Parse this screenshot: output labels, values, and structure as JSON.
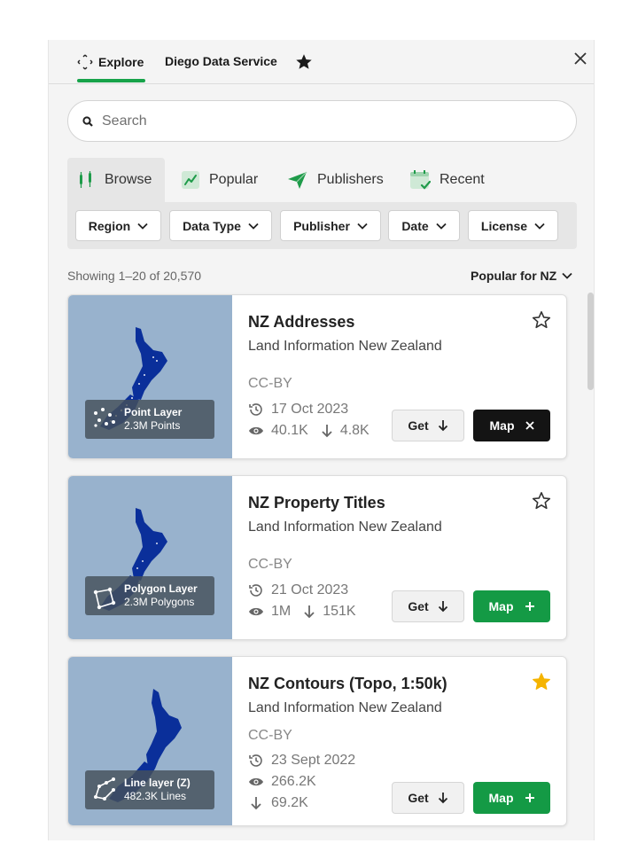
{
  "header": {
    "tabs": [
      {
        "label": "Explore",
        "active": true
      },
      {
        "label": "Diego Data Service",
        "active": false
      }
    ],
    "favorites_icon": "star-icon",
    "close_icon": "close-icon"
  },
  "search": {
    "placeholder": "Search",
    "value": ""
  },
  "nav": {
    "tabs": [
      {
        "label": "Browse",
        "icon": "browse-icon",
        "active": true
      },
      {
        "label": "Popular",
        "icon": "trend-icon",
        "active": false
      },
      {
        "label": "Publishers",
        "icon": "send-icon",
        "active": false
      },
      {
        "label": "Recent",
        "icon": "calendar-check-icon",
        "active": false
      }
    ]
  },
  "filters": [
    "Region",
    "Data Type",
    "Publisher",
    "Date",
    "License"
  ],
  "results": {
    "showing": "Showing 1–20 of 20,570",
    "sort_label": "Popular for NZ"
  },
  "cards": [
    {
      "title": "NZ Addresses",
      "publisher": "Land Information New Zealand",
      "license": "CC-BY",
      "date": "17 Oct 2023",
      "views": "40.1K",
      "downloads": "4.8K",
      "layer_type": "Point Layer",
      "layer_count": "2.3M Points",
      "starred": false,
      "get_label": "Get",
      "map_label": "Map",
      "on_map": true
    },
    {
      "title": "NZ Property Titles",
      "publisher": "Land Information New Zealand",
      "license": "CC-BY",
      "date": "21 Oct 2023",
      "views": "1M",
      "downloads": "151K",
      "layer_type": "Polygon Layer",
      "layer_count": "2.3M Polygons",
      "starred": false,
      "get_label": "Get",
      "map_label": "Map",
      "on_map": false
    },
    {
      "title": "NZ Contours (Topo, 1:50k)",
      "publisher": "Land Information New Zealand",
      "license": "CC-BY",
      "date": "23 Sept 2022",
      "views": "266.2K",
      "downloads": "69.2K",
      "layer_type": "Line layer (Z)",
      "layer_count": "482.3K Lines",
      "starred": true,
      "get_label": "Get",
      "map_label": "Map",
      "on_map": false
    }
  ],
  "colors": {
    "accent_green": "#149a45",
    "tab_underline": "#17a34a",
    "map_active": "#141414",
    "star_filled": "#f5b400",
    "thumb_bg": "#98b2cd",
    "nz_land": "#0a2f9a"
  }
}
